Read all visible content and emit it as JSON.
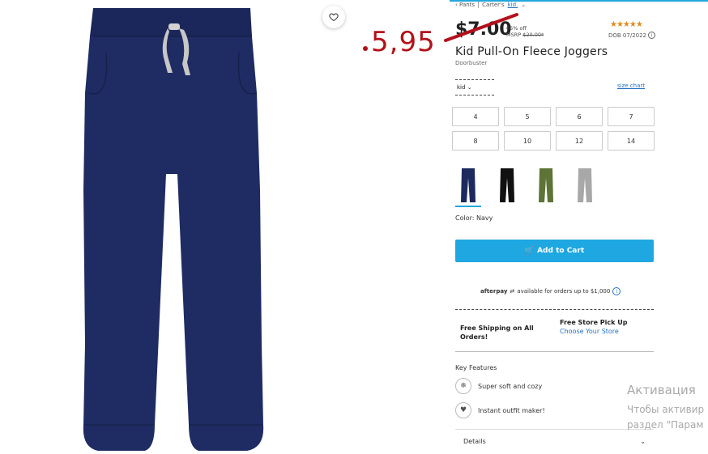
{
  "breadcrumb": {
    "back": "Pants",
    "brand": "Carter's",
    "section": "kid."
  },
  "price": {
    "new": "5,95",
    "old": "$7.00",
    "discount": "65% off",
    "msrp_label": "MSRP",
    "msrp_value": "$20.00*"
  },
  "rating": {
    "stars": "★★★★★",
    "dob": "DOB 07/2022"
  },
  "product": {
    "title": "Kid Pull-On Fleece Joggers",
    "subtitle": "Doorbuster"
  },
  "size_selector": {
    "value": "kid",
    "size_chart": "size chart"
  },
  "sizes": [
    "4",
    "5",
    "6",
    "7",
    "8",
    "10",
    "12",
    "14"
  ],
  "swatches": [
    {
      "name": "Navy",
      "color": "#1d2a5e"
    },
    {
      "name": "Black",
      "color": "#111111"
    },
    {
      "name": "Olive",
      "color": "#5e7336"
    },
    {
      "name": "Heather",
      "color": "#a8a8a8"
    }
  ],
  "color_label": "Color: Navy",
  "cart": {
    "label": "Add to Cart"
  },
  "afterpay": {
    "brand": "afterpay",
    "text": "available for orders up to $1,000"
  },
  "shipping": {
    "free_shipping": "Free Shipping on All Orders!",
    "pickup_title": "Free Store Pick Up",
    "pickup_link": "Choose Your Store"
  },
  "key_features": {
    "title": "Key Features",
    "items": [
      "Super soft and cozy",
      "Instant outfit maker!"
    ]
  },
  "details": {
    "label": "Details"
  },
  "watermark": {
    "line1": "Активация",
    "line2": "Чтобы активир",
    "line3": "раздел \"Парам"
  },
  "colors": {
    "accent": "#1ea7e1",
    "sale_red": "#b3101b",
    "navy": "#1d2a5e"
  }
}
